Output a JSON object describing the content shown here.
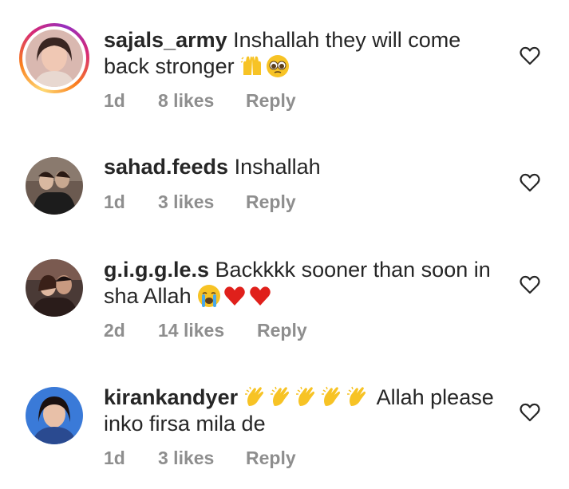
{
  "comments": [
    {
      "username": "sajals_army",
      "text": "Inshallah they will come back stronger",
      "emojis": [
        "raising-hands-emoji",
        "pleading-face-emoji"
      ],
      "time": "1d",
      "likes": "8 likes",
      "reply": "Reply",
      "has_story": true
    },
    {
      "username": "sahad.feeds",
      "text": "Inshallah",
      "emojis": [],
      "time": "1d",
      "likes": "3 likes",
      "reply": "Reply",
      "has_story": false
    },
    {
      "username": "g.i.g.g.le.s",
      "text": "Backkkk sooner than soon in sha Allah",
      "emojis": [
        "loudly-crying-face-emoji",
        "red-heart-emoji",
        "red-heart-emoji"
      ],
      "time": "2d",
      "likes": "14 likes",
      "reply": "Reply",
      "has_story": false
    },
    {
      "username": "kirankandyer",
      "text_before": "",
      "emojis": [
        "clapping-hands-emoji",
        "clapping-hands-emoji",
        "clapping-hands-emoji",
        "clapping-hands-emoji",
        "clapping-hands-emoji"
      ],
      "text": "Allah please inko firsa mila de",
      "time": "1d",
      "likes": "3 likes",
      "reply": "Reply",
      "has_story": false
    }
  ],
  "colors": {
    "text": "#262626",
    "meta": "#8e8e8e",
    "heart_outline": "#262626"
  }
}
